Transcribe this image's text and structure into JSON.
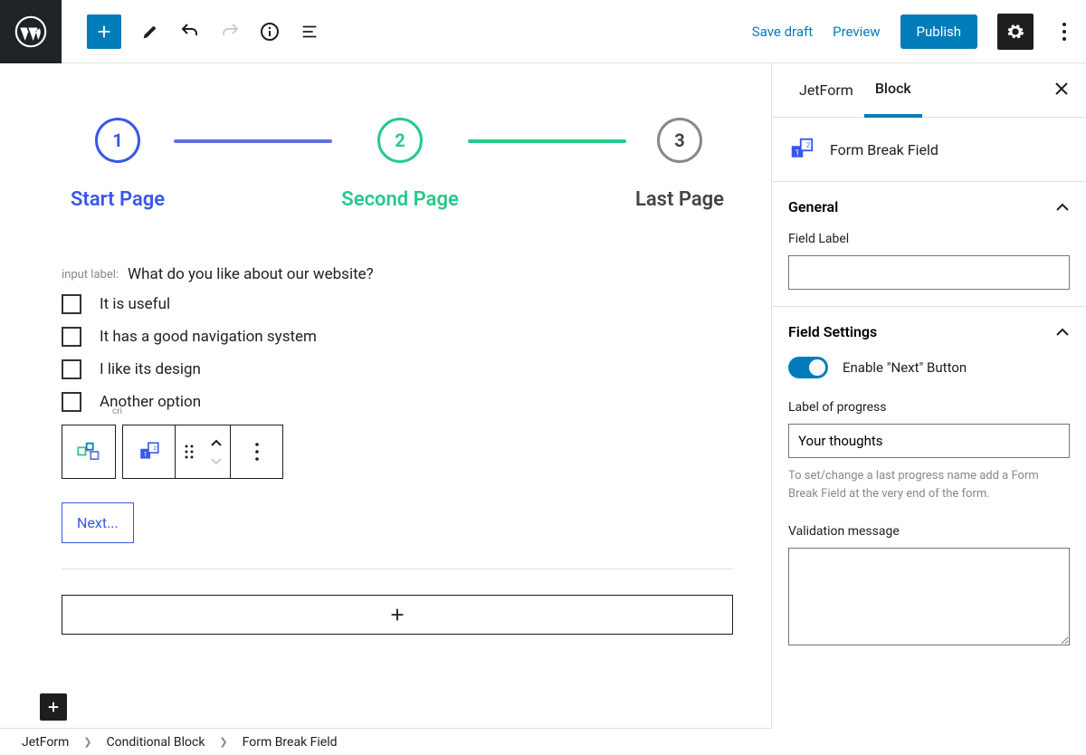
{
  "toolbar": {
    "save_draft": "Save draft",
    "preview": "Preview",
    "publish": "Publish"
  },
  "steps": [
    {
      "num": "1",
      "label": "Start Page"
    },
    {
      "num": "2",
      "label": "Second Page"
    },
    {
      "num": "3",
      "label": "Last Page"
    }
  ],
  "input_label_prefix": "input label:",
  "question": "What do you like about our website?",
  "options": [
    "It is useful",
    "It has a good navigation system",
    "I like its design",
    "Another option"
  ],
  "block_toolbar_desc_fragment": "cri",
  "next_button": "Next...",
  "sidebar": {
    "tabs": [
      "JetForm",
      "Block"
    ],
    "block_name": "Form Break Field",
    "general": {
      "title": "General",
      "field_label": "Field Label",
      "field_label_value": ""
    },
    "field_settings": {
      "title": "Field Settings",
      "enable_next": "Enable \"Next\" Button",
      "label_of_progress": "Label of progress",
      "label_of_progress_value": "Your thoughts",
      "help": "To set/change a last progress name add a Form Break Field at the very end of the form.",
      "validation_message": "Validation message",
      "validation_message_value": ""
    }
  },
  "breadcrumb": [
    "JetForm",
    "Conditional Block",
    "Form Break Field"
  ]
}
